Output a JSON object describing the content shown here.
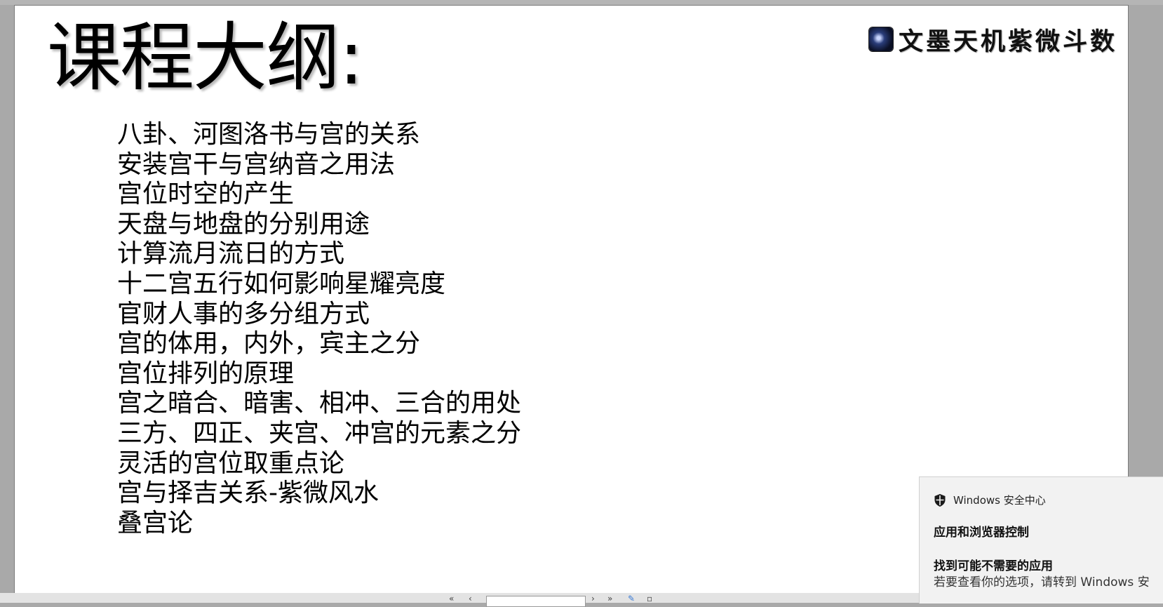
{
  "slide": {
    "title": "课程大纲:",
    "logo_text": "文墨天机紫微斗数",
    "outline": [
      "八卦、河图洛书与宫的关系",
      "安装宫干与宫纳音之用法",
      "宫位时空的产生",
      "天盘与地盘的分别用途",
      "计算流月流日的方式",
      "十二宫五行如何影响星耀亮度",
      "官财人事的多分组方式",
      "宫的体用，内外，宾主之分",
      "宫位排列的原理",
      "宫之暗合、暗害、相冲、三合的用处",
      "三方、四正、夹宫、冲宫的元素之分",
      "灵活的宫位取重点论",
      "宫与择吉关系-紫微风水",
      "叠宫论"
    ]
  },
  "notification": {
    "app_name": "Windows 安全中心",
    "heading": "应用和浏览器控制",
    "subheading": "找到可能不需要的应用",
    "body": "若要查看你的选项，请转到 Windows 安",
    "icon": "shield-icon"
  },
  "colors": {
    "background": "#a9a9a9",
    "slide": "#ffffff",
    "toast": "#f2f2f2"
  }
}
